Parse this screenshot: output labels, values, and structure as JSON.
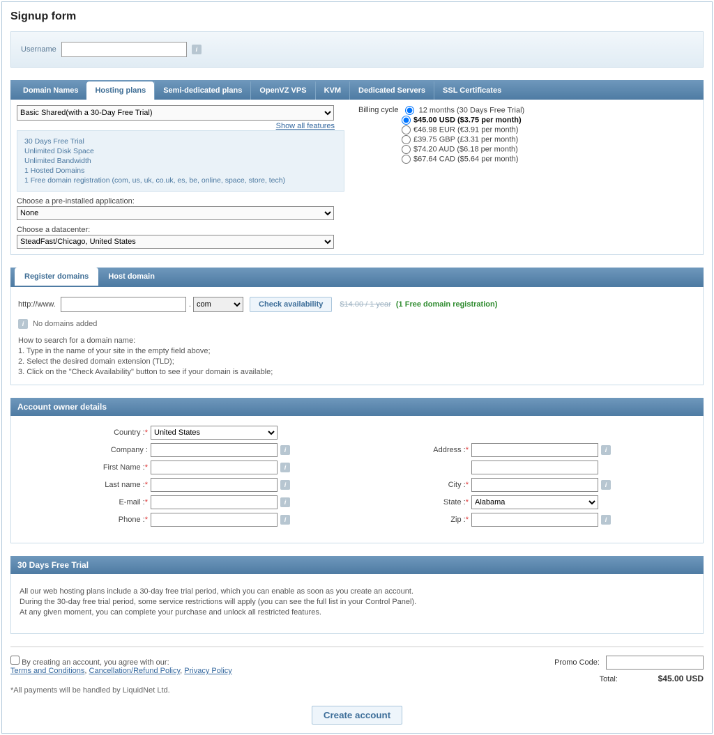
{
  "page_title": "Signup form",
  "username_label": "Username",
  "main_tabs": {
    "domain_names": "Domain Names",
    "hosting_plans": "Hosting plans",
    "semi": "Semi-dedicated plans",
    "openvz": "OpenVZ VPS",
    "kvm": "KVM",
    "dedicated": "Dedicated Servers",
    "ssl": "SSL Certificates"
  },
  "plan": {
    "selected": "Basic Shared(with a 30-Day Free Trial)",
    "show_all": "Show all features",
    "features": {
      "l1": "30 Days Free Trial",
      "l2": "Unlimited Disk Space",
      "l3": "Unlimited Bandwidth",
      "l4": "1 Hosted Domains",
      "l5": "1 Free domain registration (com, us, uk, co.uk, es, be, online, space, store, tech)"
    },
    "app_label": "Choose a pre-installed application:",
    "app_value": "None",
    "dc_label": "Choose a datacenter:",
    "dc_value": "SteadFast/Chicago, United States"
  },
  "billing": {
    "label": "Billing cycle",
    "opt1": "12 months (30 Days Free Trial)",
    "opt2": "$45.00 USD ($3.75 per month)",
    "opt3": "€46.98 EUR (€3.91 per month)",
    "opt4": "£39.75 GBP (£3.31 per month)",
    "opt5": "$74.20 AUD ($6.18 per month)",
    "opt6": "$67.64 CAD ($5.64 per month)"
  },
  "domaintabs": {
    "register": "Register domains",
    "host": "Host domain"
  },
  "domain": {
    "prefix": "http://www.",
    "tld": "com",
    "check": "Check availability",
    "strike": "$14.00 / 1 year",
    "promo": "(1 Free domain registration)",
    "none": "No domains added",
    "instr_head": "How to search for a domain name:",
    "instr_1": "1. Type in the name of your site in the empty field above;",
    "instr_2": "2. Select the desired domain extension (TLD);",
    "instr_3": "3. Click on the \"Check Availability\" button to see if your domain is available;"
  },
  "owner": {
    "section": "Account owner details",
    "country_l": "Country :",
    "country_v": "United States",
    "company_l": "Company :",
    "first_l": "First Name :",
    "last_l": "Last name :",
    "email_l": "E-mail :",
    "phone_l": "Phone :",
    "address_l": "Address :",
    "city_l": "City :",
    "state_l": "State :",
    "state_v": "Alabama",
    "zip_l": "Zip :"
  },
  "trial": {
    "section": "30 Days Free Trial",
    "l1": "All our web hosting plans include a 30-day free trial period, which you can enable as soon as you create an account.",
    "l2": "During the 30-day free trial period, some service restrictions will apply (you can see the full list in your Control Panel).",
    "l3": "At any given moment, you can complete your purchase and unlock all restricted features."
  },
  "bottom": {
    "agree": "By creating an account, you agree with our:",
    "terms": "Terms and Conditions",
    "refund": "Cancellation/Refund Policy",
    "privacy": "Privacy Policy",
    "note": "*All payments will be handled by LiquidNet Ltd.",
    "promo_l": "Promo Code:",
    "total_l": "Total:",
    "total_v": "$45.00 USD",
    "create": "Create account"
  }
}
